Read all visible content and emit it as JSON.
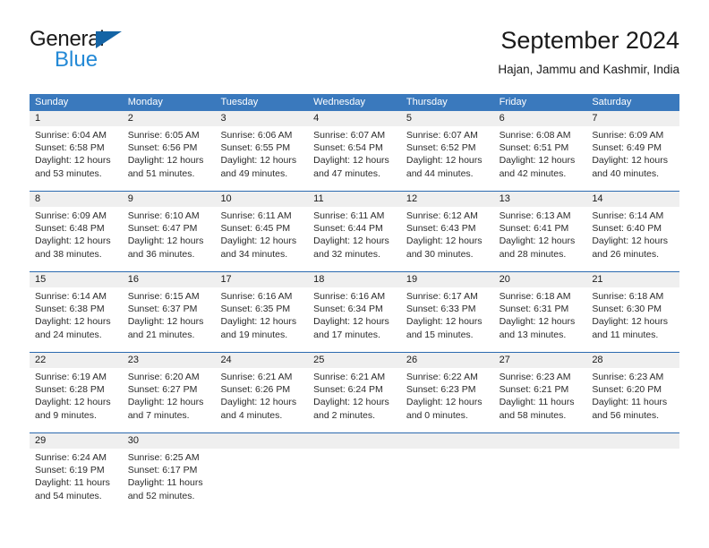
{
  "brand": {
    "name_part1": "General",
    "name_part2": "Blue",
    "triangle_color": "#1464a5",
    "blue_color": "#2389d6"
  },
  "header": {
    "title": "September 2024",
    "subtitle": "Hajan, Jammu and Kashmir, India"
  },
  "theme": {
    "header_bg": "#3a79bd",
    "week_separator": "#2c6ab0",
    "date_band_bg": "#efefef"
  },
  "calendar": {
    "weekday_headers": [
      "Sunday",
      "Monday",
      "Tuesday",
      "Wednesday",
      "Thursday",
      "Friday",
      "Saturday"
    ],
    "weeks": [
      {
        "days": [
          {
            "num": "1",
            "l1": "Sunrise: 6:04 AM",
            "l2": "Sunset: 6:58 PM",
            "l3": "Daylight: 12 hours",
            "l4": "and 53 minutes."
          },
          {
            "num": "2",
            "l1": "Sunrise: 6:05 AM",
            "l2": "Sunset: 6:56 PM",
            "l3": "Daylight: 12 hours",
            "l4": "and 51 minutes."
          },
          {
            "num": "3",
            "l1": "Sunrise: 6:06 AM",
            "l2": "Sunset: 6:55 PM",
            "l3": "Daylight: 12 hours",
            "l4": "and 49 minutes."
          },
          {
            "num": "4",
            "l1": "Sunrise: 6:07 AM",
            "l2": "Sunset: 6:54 PM",
            "l3": "Daylight: 12 hours",
            "l4": "and 47 minutes."
          },
          {
            "num": "5",
            "l1": "Sunrise: 6:07 AM",
            "l2": "Sunset: 6:52 PM",
            "l3": "Daylight: 12 hours",
            "l4": "and 44 minutes."
          },
          {
            "num": "6",
            "l1": "Sunrise: 6:08 AM",
            "l2": "Sunset: 6:51 PM",
            "l3": "Daylight: 12 hours",
            "l4": "and 42 minutes."
          },
          {
            "num": "7",
            "l1": "Sunrise: 6:09 AM",
            "l2": "Sunset: 6:49 PM",
            "l3": "Daylight: 12 hours",
            "l4": "and 40 minutes."
          }
        ]
      },
      {
        "days": [
          {
            "num": "8",
            "l1": "Sunrise: 6:09 AM",
            "l2": "Sunset: 6:48 PM",
            "l3": "Daylight: 12 hours",
            "l4": "and 38 minutes."
          },
          {
            "num": "9",
            "l1": "Sunrise: 6:10 AM",
            "l2": "Sunset: 6:47 PM",
            "l3": "Daylight: 12 hours",
            "l4": "and 36 minutes."
          },
          {
            "num": "10",
            "l1": "Sunrise: 6:11 AM",
            "l2": "Sunset: 6:45 PM",
            "l3": "Daylight: 12 hours",
            "l4": "and 34 minutes."
          },
          {
            "num": "11",
            "l1": "Sunrise: 6:11 AM",
            "l2": "Sunset: 6:44 PM",
            "l3": "Daylight: 12 hours",
            "l4": "and 32 minutes."
          },
          {
            "num": "12",
            "l1": "Sunrise: 6:12 AM",
            "l2": "Sunset: 6:43 PM",
            "l3": "Daylight: 12 hours",
            "l4": "and 30 minutes."
          },
          {
            "num": "13",
            "l1": "Sunrise: 6:13 AM",
            "l2": "Sunset: 6:41 PM",
            "l3": "Daylight: 12 hours",
            "l4": "and 28 minutes."
          },
          {
            "num": "14",
            "l1": "Sunrise: 6:14 AM",
            "l2": "Sunset: 6:40 PM",
            "l3": "Daylight: 12 hours",
            "l4": "and 26 minutes."
          }
        ]
      },
      {
        "days": [
          {
            "num": "15",
            "l1": "Sunrise: 6:14 AM",
            "l2": "Sunset: 6:38 PM",
            "l3": "Daylight: 12 hours",
            "l4": "and 24 minutes."
          },
          {
            "num": "16",
            "l1": "Sunrise: 6:15 AM",
            "l2": "Sunset: 6:37 PM",
            "l3": "Daylight: 12 hours",
            "l4": "and 21 minutes."
          },
          {
            "num": "17",
            "l1": "Sunrise: 6:16 AM",
            "l2": "Sunset: 6:35 PM",
            "l3": "Daylight: 12 hours",
            "l4": "and 19 minutes."
          },
          {
            "num": "18",
            "l1": "Sunrise: 6:16 AM",
            "l2": "Sunset: 6:34 PM",
            "l3": "Daylight: 12 hours",
            "l4": "and 17 minutes."
          },
          {
            "num": "19",
            "l1": "Sunrise: 6:17 AM",
            "l2": "Sunset: 6:33 PM",
            "l3": "Daylight: 12 hours",
            "l4": "and 15 minutes."
          },
          {
            "num": "20",
            "l1": "Sunrise: 6:18 AM",
            "l2": "Sunset: 6:31 PM",
            "l3": "Daylight: 12 hours",
            "l4": "and 13 minutes."
          },
          {
            "num": "21",
            "l1": "Sunrise: 6:18 AM",
            "l2": "Sunset: 6:30 PM",
            "l3": "Daylight: 12 hours",
            "l4": "and 11 minutes."
          }
        ]
      },
      {
        "days": [
          {
            "num": "22",
            "l1": "Sunrise: 6:19 AM",
            "l2": "Sunset: 6:28 PM",
            "l3": "Daylight: 12 hours",
            "l4": "and 9 minutes."
          },
          {
            "num": "23",
            "l1": "Sunrise: 6:20 AM",
            "l2": "Sunset: 6:27 PM",
            "l3": "Daylight: 12 hours",
            "l4": "and 7 minutes."
          },
          {
            "num": "24",
            "l1": "Sunrise: 6:21 AM",
            "l2": "Sunset: 6:26 PM",
            "l3": "Daylight: 12 hours",
            "l4": "and 4 minutes."
          },
          {
            "num": "25",
            "l1": "Sunrise: 6:21 AM",
            "l2": "Sunset: 6:24 PM",
            "l3": "Daylight: 12 hours",
            "l4": "and 2 minutes."
          },
          {
            "num": "26",
            "l1": "Sunrise: 6:22 AM",
            "l2": "Sunset: 6:23 PM",
            "l3": "Daylight: 12 hours",
            "l4": "and 0 minutes."
          },
          {
            "num": "27",
            "l1": "Sunrise: 6:23 AM",
            "l2": "Sunset: 6:21 PM",
            "l3": "Daylight: 11 hours",
            "l4": "and 58 minutes."
          },
          {
            "num": "28",
            "l1": "Sunrise: 6:23 AM",
            "l2": "Sunset: 6:20 PM",
            "l3": "Daylight: 11 hours",
            "l4": "and 56 minutes."
          }
        ]
      },
      {
        "days": [
          {
            "num": "29",
            "l1": "Sunrise: 6:24 AM",
            "l2": "Sunset: 6:19 PM",
            "l3": "Daylight: 11 hours",
            "l4": "and 54 minutes."
          },
          {
            "num": "30",
            "l1": "Sunrise: 6:25 AM",
            "l2": "Sunset: 6:17 PM",
            "l3": "Daylight: 11 hours",
            "l4": "and 52 minutes."
          },
          {
            "num": "",
            "l1": "",
            "l2": "",
            "l3": "",
            "l4": ""
          },
          {
            "num": "",
            "l1": "",
            "l2": "",
            "l3": "",
            "l4": ""
          },
          {
            "num": "",
            "l1": "",
            "l2": "",
            "l3": "",
            "l4": ""
          },
          {
            "num": "",
            "l1": "",
            "l2": "",
            "l3": "",
            "l4": ""
          },
          {
            "num": "",
            "l1": "",
            "l2": "",
            "l3": "",
            "l4": ""
          }
        ]
      }
    ]
  }
}
